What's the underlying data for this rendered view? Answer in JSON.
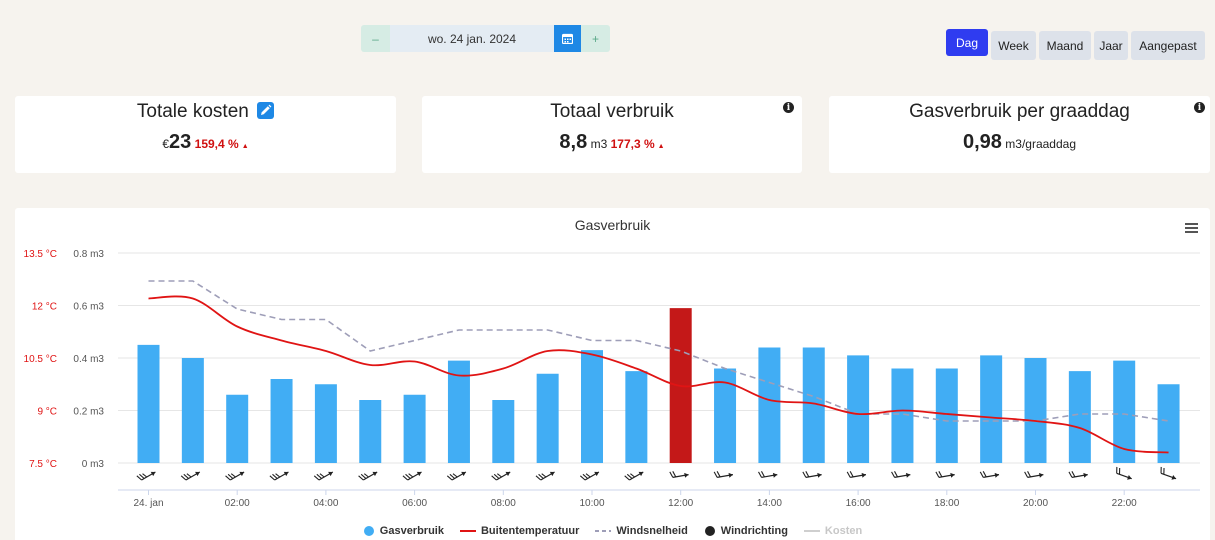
{
  "datepicker": {
    "minus": "–",
    "date": "wo. 24 jan. 2024",
    "plus": "+"
  },
  "period_buttons": [
    "Dag",
    "Week",
    "Maand",
    "Jaar",
    "Aangepast"
  ],
  "period_active": "Dag",
  "cards": {
    "costs": {
      "title": "Totale kosten",
      "currency": "€",
      "value": "23",
      "pct": "159,4 %"
    },
    "usage": {
      "title": "Totaal verbruik",
      "value": "8,8",
      "unit": "m3",
      "pct": "177,3 %"
    },
    "degree": {
      "title": "Gasverbruik per graaddag",
      "value": "0,98",
      "unit": "m3/graaddag"
    }
  },
  "colors": {
    "bar": "#41adf4",
    "bar_highlight": "#c41818",
    "temp": "#e01414",
    "wind": "#9e9eb8",
    "accent": "#2f3cf0"
  },
  "chart_data": {
    "type": "bar",
    "title": "Gasverbruik",
    "x": [
      "00:00",
      "01:00",
      "02:00",
      "03:00",
      "04:00",
      "05:00",
      "06:00",
      "07:00",
      "08:00",
      "09:00",
      "10:00",
      "11:00",
      "12:00",
      "13:00",
      "14:00",
      "15:00",
      "16:00",
      "17:00",
      "18:00",
      "19:00",
      "20:00",
      "21:00",
      "22:00",
      "23:00"
    ],
    "x_tick_labels": [
      "24. jan",
      "02:00",
      "04:00",
      "06:00",
      "08:00",
      "10:00",
      "12:00",
      "14:00",
      "16:00",
      "18:00",
      "20:00",
      "22:00"
    ],
    "y_left_ticks": [
      "0 m3",
      "0.2 m3",
      "0.4 m3",
      "0.6 m3",
      "0.8 m3"
    ],
    "y_temp_ticks": [
      "7.5 °C",
      "9 °C",
      "10.5 °C",
      "12 °C",
      "13.5 °C"
    ],
    "ylim": [
      0,
      0.8
    ],
    "temp_lim": [
      7.5,
      13.5
    ],
    "highlight_index": 12,
    "series": [
      {
        "name": "Gasverbruik",
        "type": "bar",
        "values": [
          0.45,
          0.4,
          0.26,
          0.32,
          0.3,
          0.24,
          0.26,
          0.39,
          0.24,
          0.34,
          0.43,
          0.35,
          0.59,
          0.36,
          0.44,
          0.44,
          0.41,
          0.36,
          0.36,
          0.41,
          0.4,
          0.35,
          0.39,
          0.3
        ]
      },
      {
        "name": "Buitentemperatuur",
        "type": "line",
        "values": [
          12.2,
          12.2,
          11.4,
          11.0,
          10.7,
          10.3,
          10.4,
          10.0,
          10.2,
          10.7,
          10.6,
          10.2,
          9.7,
          9.8,
          9.3,
          9.2,
          8.9,
          9.0,
          8.9,
          8.8,
          8.7,
          8.5,
          7.9,
          7.8
        ]
      },
      {
        "name": "Windsnelheid",
        "type": "line",
        "values": [
          12.7,
          12.7,
          11.9,
          11.6,
          11.6,
          10.7,
          11.0,
          11.3,
          11.3,
          11.3,
          11.0,
          11.0,
          10.7,
          10.2,
          9.8,
          9.4,
          8.9,
          8.9,
          8.7,
          8.7,
          8.7,
          8.9,
          8.9,
          8.7
        ]
      },
      {
        "name": "Windrichting",
        "type": "marker",
        "values": [
          60,
          60,
          60,
          60,
          60,
          60,
          60,
          60,
          60,
          60,
          60,
          60,
          80,
          80,
          80,
          80,
          80,
          80,
          80,
          80,
          80,
          80,
          110,
          110
        ]
      },
      {
        "name": "Kosten",
        "type": "line",
        "hidden": true,
        "values": []
      }
    ]
  }
}
